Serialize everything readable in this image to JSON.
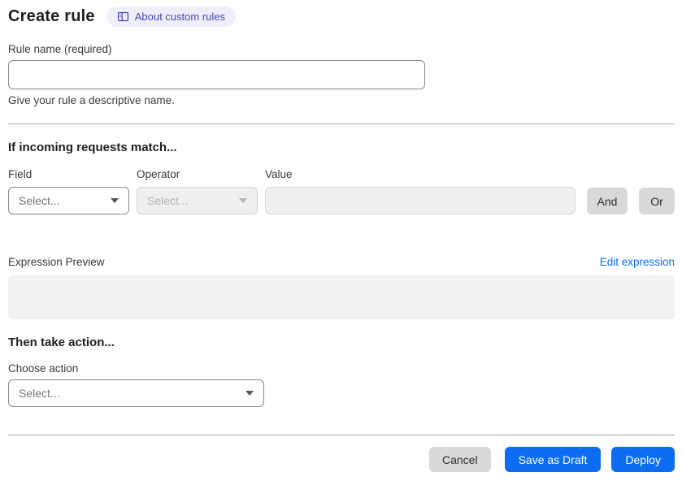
{
  "page": {
    "title": "Create rule",
    "badge": {
      "label": "About custom rules",
      "icon": "book-icon"
    }
  },
  "rule_name": {
    "label": "Rule name (required)",
    "value": "",
    "helper": "Give your rule a descriptive name."
  },
  "match_section": {
    "heading": "If incoming requests match...",
    "field": {
      "label": "Field",
      "value": "Select...",
      "disabled": false
    },
    "operator": {
      "label": "Operator",
      "value": "Select...",
      "disabled": true
    },
    "value": {
      "label": "Value",
      "value": "",
      "disabled": true
    },
    "and_button": "And",
    "or_button": "Or",
    "expression_preview_label": "Expression Preview",
    "edit_expression_link": "Edit expression",
    "expression_value": ""
  },
  "action_section": {
    "heading": "Then take action...",
    "choose_action_label": "Choose action",
    "action_select_value": "Select..."
  },
  "footer": {
    "cancel_label": "Cancel",
    "save_draft_label": "Save as Draft",
    "deploy_label": "Deploy"
  },
  "colors": {
    "accent_blue": "#0c6df2",
    "badge_bg": "#efeef9",
    "badge_text": "#4744c0",
    "button_gray": "#d9d9d9",
    "disabled_bg": "#efefef",
    "expression_box_bg": "#f2f2f2"
  }
}
